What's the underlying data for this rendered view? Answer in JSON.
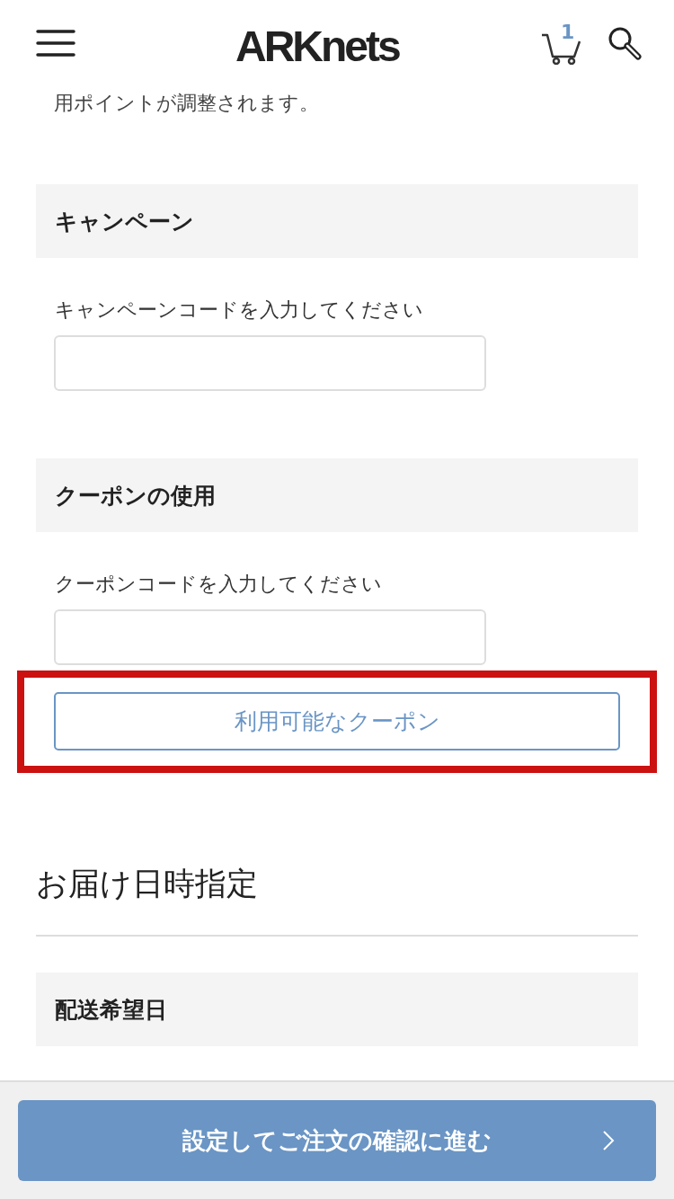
{
  "header": {
    "logo": "ARKnets",
    "cart_count": "1"
  },
  "cut_note": "用ポイントが調整されます。",
  "sections": [
    {
      "title": "キャンペーン",
      "label": "キャンペーンコードを入力してください"
    },
    {
      "title": "クーポンの使用",
      "label": "クーポンコードを入力してください",
      "button": "利用可能なクーポン",
      "highlighted": true
    }
  ],
  "delivery": {
    "heading": "お届け日時指定",
    "subsection": "配送希望日"
  },
  "footer": {
    "button": "設定してご注文の確認に進む"
  }
}
